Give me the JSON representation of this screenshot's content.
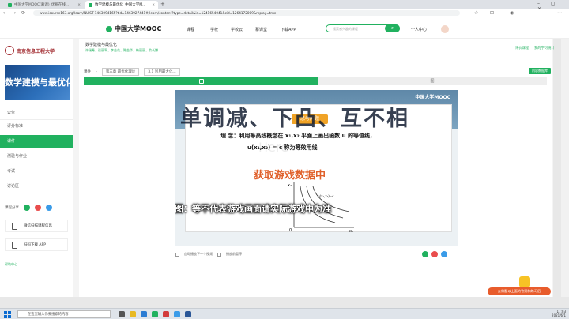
{
  "browser": {
    "tabs": [
      {
        "title": "中国大学MOOC(慕课)_优质在线..."
      },
      {
        "title": "数学建模与最优化_中国大学M..."
      }
    ],
    "new_tab": "+",
    "address": "www.icourse163.org/learn/NUIST-1463094165?tid=1463927441#/learn/content?type=detail&id=1241654041&cid=1264172009&replay=true"
  },
  "header": {
    "logo": "中国大学MOOC",
    "nav": [
      "课程",
      "学校",
      "学校云",
      "慕课堂",
      "下载APP"
    ],
    "search_placeholder": "搜索感兴趣的课程",
    "user": "个人中心"
  },
  "sidebar": {
    "school": "南京信息工程大学",
    "banner": "数学建模与最优化",
    "items": [
      {
        "label": "公告"
      },
      {
        "label": "评分标准"
      },
      {
        "label": "课件"
      },
      {
        "label": "测验与作业"
      },
      {
        "label": "考试"
      },
      {
        "label": "讨论区"
      }
    ],
    "share_label": "课程分享",
    "cards": [
      {
        "label": "微信扫描课程信息"
      },
      {
        "label": "扫码下载 APP"
      }
    ],
    "help": "帮助中心"
  },
  "content": {
    "title": "数学建模与最优化",
    "subtitle": "许瑞希、张丽翠、李金花、陈金华、韩丽丽、俞长博",
    "breadcrumb": [
      "课件",
      "第三章 最优化理论",
      "3.1 利用最大化..."
    ],
    "tab2": "图",
    "right_links": [
      "评价课程",
      "我的学习统计"
    ],
    "green_btn": "内容数据库"
  },
  "video": {
    "big_subtitle": "单调减、下凸、互不相",
    "brand": "中国大学MOOC",
    "slide_tag": "思考问题",
    "slide_line1": "理 念：利用等高线概念在 x₁,x₂ 平面上画出函数 u 的等值线，",
    "slide_line2": "u(x₁,x₂) = c 称为等效用线",
    "watermark": "Here",
    "loading": "获取游戏数据中",
    "overlay_text": "此类示图：等不代表游戏画面请实际游戏中为准",
    "plot_label": "u(x₁,x₂)=c",
    "axis_x": "x₁",
    "axis_y": "x₂",
    "axis_origin": "0"
  },
  "controls": {
    "auto_next": "自动播放下一个视频",
    "mark": "播放前暂停"
  },
  "float_bar": "去做题以上面的答案和练习后",
  "taskbar": {
    "search": "在这里输入你要搜索的内容",
    "time": "17:03",
    "date": "2021/6/1"
  }
}
